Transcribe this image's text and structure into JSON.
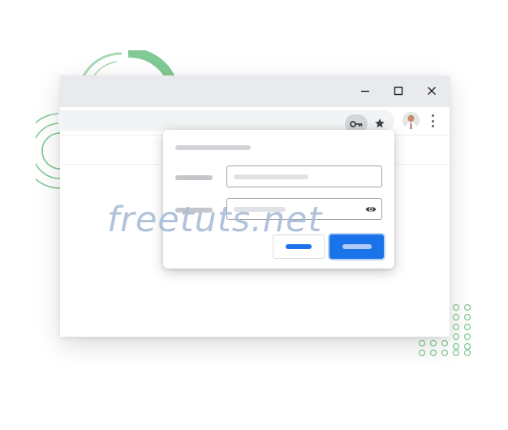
{
  "watermark": "freetuts.net",
  "icons": {
    "minimize": "minimize-icon",
    "maximize": "maximize-icon",
    "close": "close-icon",
    "key": "key-icon",
    "star": "star-icon",
    "avatar": "profile-avatar",
    "menu": "more-vert-icon",
    "eye": "eye-icon"
  },
  "colors": {
    "accent": "#1a73e8",
    "deco_green": "#81c995",
    "titlebar": "#e8eaed",
    "placeholder_bar": "#dadce0"
  }
}
